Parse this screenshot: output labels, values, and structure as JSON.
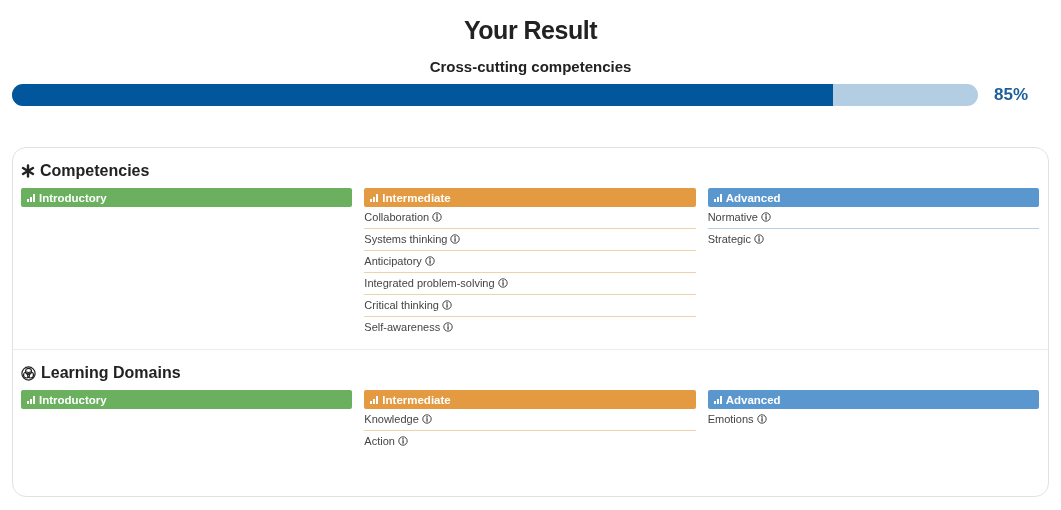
{
  "title": "Your Result",
  "subtitle": "Cross-cutting competencies",
  "progress": {
    "level": 0.85,
    "reading": "85%"
  },
  "sections": [
    {
      "kind": "competencies",
      "title": "Competencies",
      "columns": [
        {
          "kind": "introductory",
          "label": "Introductory"
        },
        {
          "kind": "intermediate",
          "label": "Intermediate",
          "items": [
            "Collaboration",
            "Systems thinking",
            "Anticipatory",
            "Integrated problem-solving",
            "Critical thinking",
            "Self-awareness"
          ]
        },
        {
          "kind": "advanced",
          "label": "Advanced",
          "items": [
            "Normative",
            "Strategic"
          ]
        }
      ]
    },
    {
      "kind": "domains",
      "title": "Learning Domains",
      "columns": [
        {
          "kind": "introductory",
          "label": "Introductory"
        },
        {
          "kind": "intermediate",
          "label": "Intermediate",
          "items": [
            "Knowledge",
            "Action"
          ]
        },
        {
          "kind": "advanced",
          "label": "Advanced",
          "items": [
            "Emotions"
          ]
        }
      ]
    }
  ]
}
